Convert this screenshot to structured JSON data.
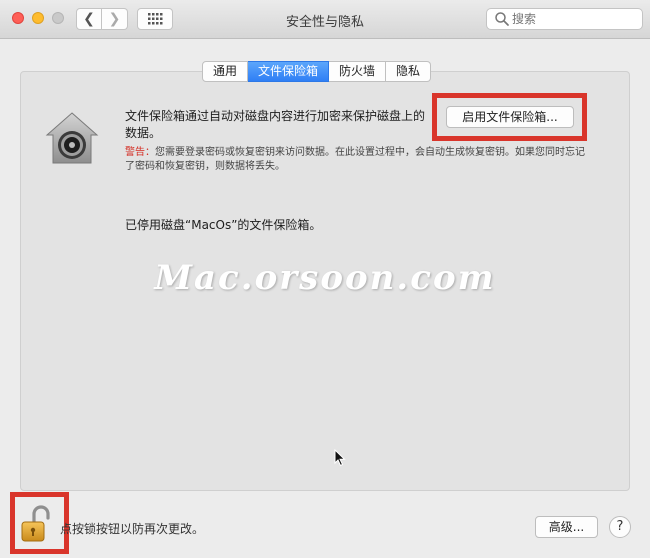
{
  "window": {
    "title": "安全性与隐私"
  },
  "search": {
    "placeholder": "搜索"
  },
  "tabs": [
    {
      "label": "通用",
      "active": false
    },
    {
      "label": "文件保险箱",
      "active": true
    },
    {
      "label": "防火墙",
      "active": false
    },
    {
      "label": "隐私",
      "active": false
    }
  ],
  "filevault": {
    "description": "文件保险箱通过自动对磁盘内容进行加密来保护磁盘上的数据。",
    "enable_button": "启用文件保险箱...",
    "warning_label": "警告：",
    "warning_text": "您需要登录密码或恢复密钥来访问数据。在此设置过程中，会自动生成恢复密钥。如果您同时忘记了密码和恢复密钥，则数据将丢失。",
    "status": "已停用磁盘“MacOs”的文件保险箱。"
  },
  "watermark": "Mac.orsoon.com",
  "footer": {
    "lock_hint": "点按锁按钮以防再次更改。",
    "advanced_button": "高级...",
    "help_button": "?"
  },
  "colors": {
    "highlight": "#d9352b",
    "active_tab": "#2f7ff5",
    "warning": "#d32a20"
  }
}
